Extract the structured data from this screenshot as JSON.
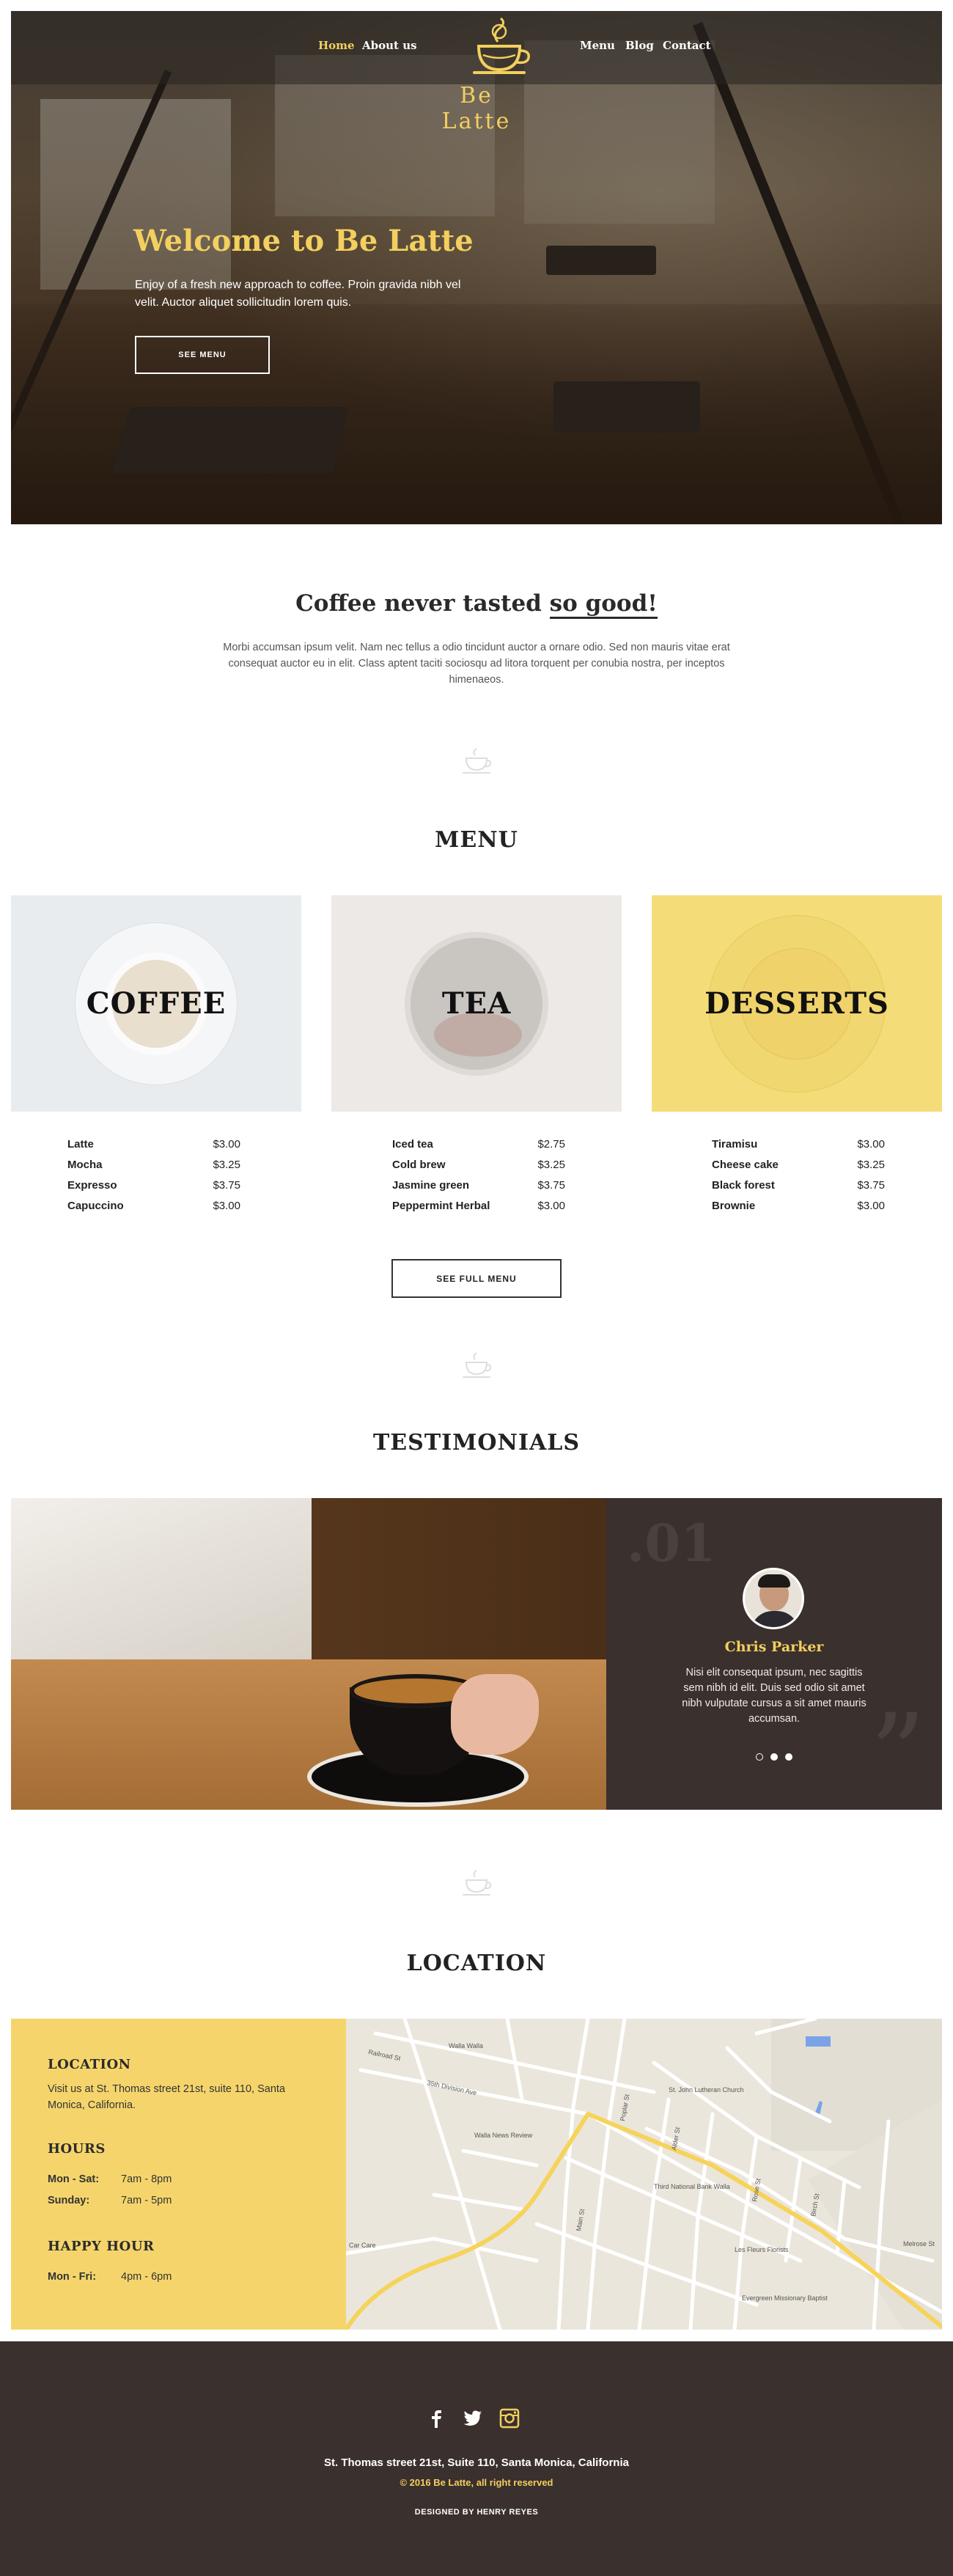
{
  "colors": {
    "accent": "#f3cf5f",
    "dark": "#3a302d",
    "loc_panel": "#f5d56b"
  },
  "nav": {
    "items": [
      "Home",
      "About us",
      "Menu",
      "Blog",
      "Contact"
    ],
    "active": "Home",
    "logo_text": "Be Latte"
  },
  "hero": {
    "title": "Welcome to Be Latte",
    "text": "Enjoy of a fresh new approach to coffee. Proin gravida nibh vel velit. Auctor aliquet sollicitudin lorem quis.",
    "button": "SEE MENU"
  },
  "intro": {
    "title_plain": "Coffee never tasted ",
    "title_underlined": "so good!",
    "text": "Morbi accumsan ipsum velit. Nam nec tellus a odio tincidunt auctor a ornare odio. Sed non  mauris vitae erat consequat auctor eu in elit. Class aptent taciti sociosqu ad litora torquent per conubia nostra, per inceptos himenaeos."
  },
  "menu": {
    "title": "MENU",
    "categories": [
      {
        "label": "COFFEE",
        "items": [
          {
            "name": "Latte",
            "price": "$3.00"
          },
          {
            "name": "Mocha",
            "price": "$3.25"
          },
          {
            "name": "Expresso",
            "price": "$3.75"
          },
          {
            "name": "Capuccino",
            "price": "$3.00"
          }
        ]
      },
      {
        "label": "TEA",
        "items": [
          {
            "name": "Iced tea",
            "price": "$2.75"
          },
          {
            "name": "Cold brew",
            "price": "$3.25"
          },
          {
            "name": "Jasmine green",
            "price": "$3.75"
          },
          {
            "name": "Peppermint Herbal",
            "price": "$3.00"
          }
        ]
      },
      {
        "label": "DESSERTS",
        "items": [
          {
            "name": "Tiramisu",
            "price": "$3.00"
          },
          {
            "name": "Cheese cake",
            "price": "$3.25"
          },
          {
            "name": "Black forest",
            "price": "$3.75"
          },
          {
            "name": "Brownie",
            "price": "$3.00"
          }
        ]
      }
    ],
    "button": "SEE FULL MENU"
  },
  "testimonials": {
    "title": "TESTIMONIALS",
    "number": ".01",
    "name": "Chris Parker",
    "text": "Nisi elit consequat ipsum, nec sagittis sem nibh id elit. Duis sed odio sit amet nibh vulputate cursus a sit amet mauris accumsan.",
    "slides": 3,
    "active_slide": 1
  },
  "location": {
    "title": "LOCATION",
    "location_heading": "LOCATION",
    "location_text": "Visit us at St. Thomas street 21st, suite 110, Santa Monica, California.",
    "hours_heading": "HOURS",
    "hours": [
      {
        "day": "Mon - Sat:",
        "time": "7am - 8pm"
      },
      {
        "day": "Sunday:",
        "time": "7am - 5pm"
      }
    ],
    "happy_heading": "HAPPY HOUR",
    "happy": [
      {
        "day": "Mon - Fri:",
        "time": "4pm - 6pm"
      }
    ],
    "map_labels": [
      "Walla Walla",
      "Railroad St",
      "35th Division Ave",
      "Walla News Review",
      "St. John Lutheran Church",
      "Third National Bank Walla",
      "Evergreen Missionary Baptist",
      "Les Fleurs Florists",
      "Car Care",
      "Poplar St",
      "Alder St",
      "Main St",
      "Rose St",
      "Birch St",
      "Melrose St"
    ]
  },
  "footer": {
    "social": [
      "facebook-icon",
      "twitter-icon",
      "instagram-icon"
    ],
    "address": "St. Thomas street 21st, Suite 110, Santa Monica, California",
    "copyright": "© 2016 Be Latte, all right reserved",
    "designer": "DESIGNED BY HENRY REYES"
  }
}
